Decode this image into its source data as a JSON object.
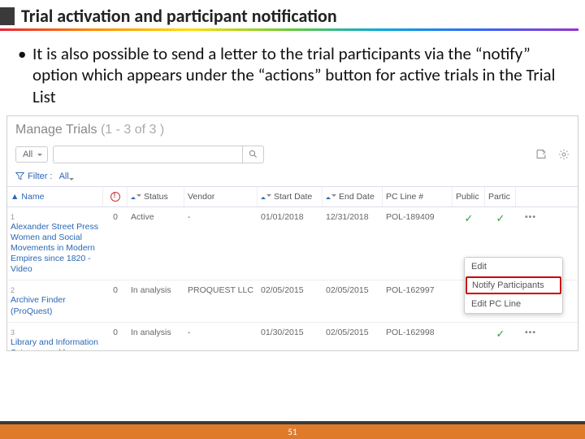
{
  "slide": {
    "title": "Trial activation and participant notification",
    "bullet": "It is also possible to send a letter to the trial participants via the “notify” option which appears under the “actions” button for active trials in the Trial List",
    "page_number": "51"
  },
  "app": {
    "header": "Manage Trials",
    "count": "(1 - 3 of 3 )",
    "scope_dropdown": "All",
    "search_placeholder": "",
    "filter_label": "Filter :",
    "filter_value": "All"
  },
  "columns": {
    "name": "Name",
    "status": "Status",
    "vendor": "Vendor",
    "start": "Start Date",
    "end": "End Date",
    "pol": "PC Line #",
    "pub": "Public",
    "part": "Partic"
  },
  "rows": [
    {
      "idx": "1",
      "name": "Alexander Street Press Women and Social Movements in Modern Empires since 1820 - Video",
      "o": "0",
      "status": "Active",
      "vendor": "-",
      "start": "01/01/2018",
      "end": "12/31/2018",
      "pol": "POL-189409",
      "pub": "✓",
      "part": "✓"
    },
    {
      "idx": "2",
      "name": "Archive Finder (ProQuest)",
      "o": "0",
      "status": "In analysis",
      "vendor": "PROQUEST LLC",
      "start": "02/05/2015",
      "end": "02/05/2015",
      "pol": "POL-162997",
      "pub": "",
      "part": "✓"
    },
    {
      "idx": "3",
      "name": "Library and Information Science weekly",
      "o": "0",
      "status": "In analysis",
      "vendor": "-",
      "start": "01/30/2015",
      "end": "02/05/2015",
      "pol": "POL-162998",
      "pub": "",
      "part": "✓"
    }
  ],
  "menu": {
    "edit": "Edit",
    "notify": "Notify Participants",
    "editpo": "Edit PC Line"
  }
}
